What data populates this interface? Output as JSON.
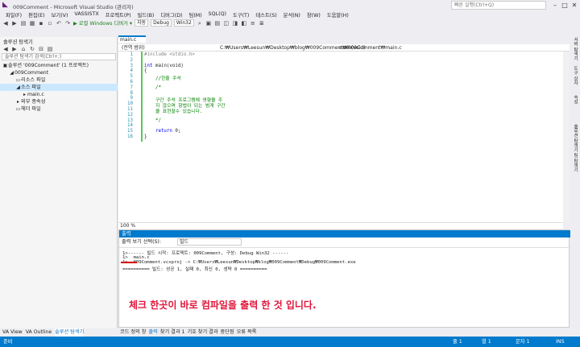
{
  "window": {
    "title": "009Comment - Microsoft Visual Studio (관리자)",
    "quick_launch_placeholder": "빠른 실행(Ctrl+Q)",
    "minimize": "–",
    "restore": "□",
    "close": "✕"
  },
  "menu": [
    "파일(F)",
    "편집(E)",
    "보기(V)",
    "VASSISTX",
    "프로젝트(P)",
    "빌드(B)",
    "디버그(D)",
    "팀(M)",
    "SQL(Q)",
    "도구(T)",
    "테스트(S)",
    "분석(N)",
    "창(W)",
    "도움말(H)"
  ],
  "toolbar": {
    "run_label": "▶ 로컬 Windows 디버거 ▾",
    "mode": "자동",
    "config": "Debug",
    "platform": "Win32"
  },
  "solution_explorer": {
    "title": "솔루션 탐색기",
    "search_placeholder": "솔루션 탐색기 검색(Ctrl+;)",
    "tree": [
      {
        "label": "솔루션 '009Comment' (1 프로젝트)",
        "icon": "▣",
        "indent": 0,
        "selected": false
      },
      {
        "label": "009Comment",
        "icon": "◢",
        "indent": 1,
        "selected": false
      },
      {
        "label": "리소스 파일",
        "icon": "▭",
        "indent": 2,
        "selected": false
      },
      {
        "label": "소스 파일",
        "icon": "◢",
        "indent": 2,
        "selected": true
      },
      {
        "label": "main.c",
        "icon": "▸",
        "indent": 3,
        "selected": false
      },
      {
        "label": "외부 종속성",
        "icon": "▸",
        "indent": 2,
        "selected": false
      },
      {
        "label": "헤더 파일",
        "icon": "▭",
        "indent": 2,
        "selected": false
      }
    ],
    "bottom_tabs": [
      {
        "label": "VA View",
        "active": false
      },
      {
        "label": "VA Outline",
        "active": false
      },
      {
        "label": "솔루션 탐색기",
        "active": true
      }
    ]
  },
  "editor": {
    "tab_label": "main.c",
    "path": "C:₩Users₩Leesun₩Desktop₩blog₩009Comment₩009Comment₩main.c",
    "scope": "(전역 범위)",
    "function": "main(void)",
    "zoom": "100 %",
    "lines": [
      {
        "n": "1",
        "parts": [
          {
            "t": "#include <stdio.h>",
            "c": "pp"
          }
        ]
      },
      {
        "n": "2",
        "parts": [
          {
            "t": "",
            "c": ""
          }
        ]
      },
      {
        "n": "3",
        "parts": [
          {
            "t": "int",
            "c": "kw"
          },
          {
            "t": " main(void)",
            "c": ""
          }
        ]
      },
      {
        "n": "4",
        "parts": [
          {
            "t": "{",
            "c": ""
          }
        ]
      },
      {
        "n": "5",
        "parts": [
          {
            "t": "    //한줄 주석",
            "c": "cm"
          }
        ]
      },
      {
        "n": "6",
        "parts": [
          {
            "t": "",
            "c": ""
          }
        ]
      },
      {
        "n": "7",
        "parts": [
          {
            "t": "    /*",
            "c": "cm"
          }
        ]
      },
      {
        "n": "8",
        "parts": [
          {
            "t": "",
            "c": ""
          }
        ]
      },
      {
        "n": "9",
        "parts": [
          {
            "t": "    구간 주석 프로그램에 영향을 주",
            "c": "cm"
          }
        ]
      },
      {
        "n": "10",
        "parts": [
          {
            "t": "    지 않으며 항법이 되는 범게 구간",
            "c": "cm"
          }
        ]
      },
      {
        "n": "11",
        "parts": [
          {
            "t": "    을 표현할수 있습니다.",
            "c": "cm"
          }
        ]
      },
      {
        "n": "12",
        "parts": [
          {
            "t": "",
            "c": ""
          }
        ]
      },
      {
        "n": "13",
        "parts": [
          {
            "t": "    */",
            "c": "cm"
          }
        ]
      },
      {
        "n": "14",
        "parts": [
          {
            "t": "",
            "c": ""
          }
        ]
      },
      {
        "n": "15",
        "parts": [
          {
            "t": "    return",
            "c": "kw"
          },
          {
            "t": " 0;",
            "c": ""
          }
        ]
      },
      {
        "n": "16",
        "parts": [
          {
            "t": "}",
            "c": ""
          }
        ]
      }
    ]
  },
  "right_rail": [
    "서버 탐색기",
    "도구 상자",
    "속성",
    "솔루션 탐색기",
    "팀 탐색기"
  ],
  "output": {
    "title": "출력",
    "source_label": "출력 보기 선택(S):",
    "source_value": "빌드",
    "lines": [
      "1>------ 빌드 시작: 프로젝트: 009Comment, 구성: Debug Win32 ------",
      "1>  main.c",
      "1>  009Comment.vcxproj -> C:₩Users₩Leesun₩Desktop₩blog₩009Comment₩Debug₩009Comment.exe",
      "========== 빌드: 성공 1, 실패 0, 최신 0, 생략 0 =========="
    ],
    "annotation": "체크 한곳이 바로 컴파일을 출력 한 것 입니다.",
    "annotation_color": "#e0163a"
  },
  "output_tabs": [
    {
      "label": "코드 정의 창",
      "active": false
    },
    {
      "label": "출력",
      "active": true
    },
    {
      "label": "찾기 결과 1",
      "active": false
    },
    {
      "label": "기호 찾기 결과",
      "active": false
    },
    {
      "label": "중단점",
      "active": false
    },
    {
      "label": "오류 목록",
      "active": false
    }
  ],
  "status": {
    "left": "준비",
    "line": "줄 1",
    "col": "열 1",
    "char": "문자 1",
    "mode": "INS"
  },
  "accent": "#007acc"
}
